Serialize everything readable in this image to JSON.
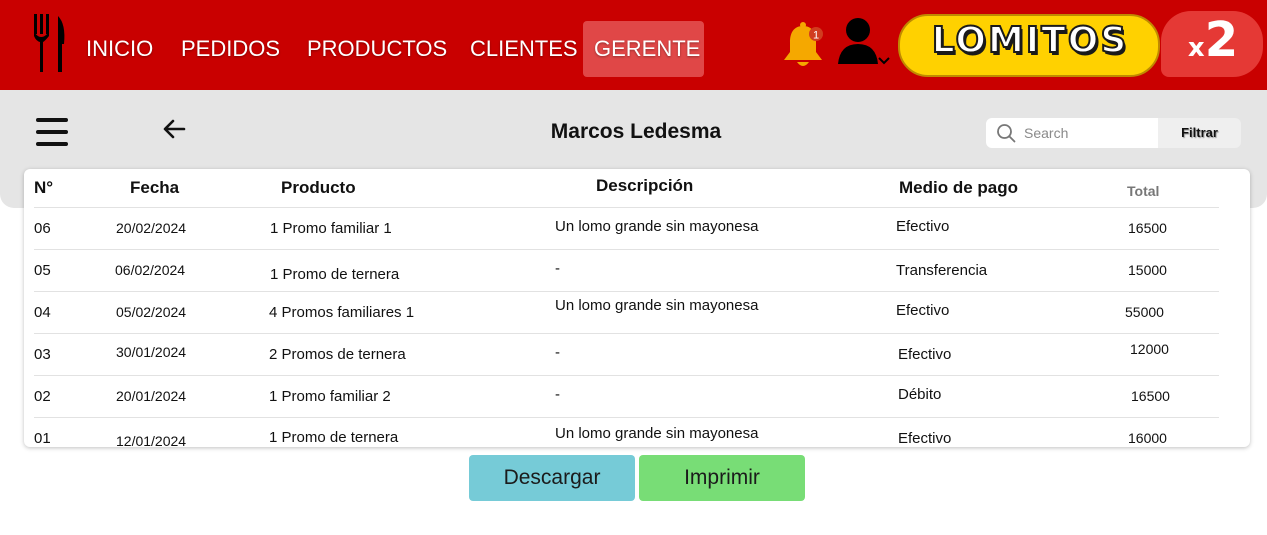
{
  "nav": {
    "items": [
      "INICIO",
      "PEDIDOS",
      "PRODUCTOS",
      "CLIENTES",
      "GERENTE"
    ],
    "active": "GERENTE",
    "notification_count": "1"
  },
  "brand": {
    "name": "LOMITOS",
    "multiplier_x": "x",
    "multiplier_n": "2"
  },
  "header": {
    "title": "Marcos Ledesma"
  },
  "search": {
    "placeholder": "Search",
    "filter_label": "Filtrar"
  },
  "table": {
    "columns": [
      "N°",
      "Fecha",
      "Producto",
      "Descripción",
      "Medio de pago",
      "Total"
    ],
    "rows": [
      [
        "06",
        "20/02/2024",
        "1 Promo familiar 1",
        "Un lomo grande sin mayonesa",
        "Efectivo",
        "16500"
      ],
      [
        "05",
        "06/02/2024",
        "1 Promo de ternera",
        "-",
        "Transferencia",
        "15000"
      ],
      [
        "04",
        "05/02/2024",
        "4 Promos familiares 1",
        "Un lomo grande sin mayonesa",
        "Efectivo",
        "55000"
      ],
      [
        "03",
        "30/01/2024",
        "2 Promos de ternera",
        "-",
        "Efectivo",
        "12000"
      ],
      [
        "02",
        "20/01/2024",
        "1 Promo familiar 2",
        "-",
        "Débito",
        "16500"
      ],
      [
        "01",
        "12/01/2024",
        "1 Promo de ternera",
        "Un lomo grande sin mayonesa",
        "Efectivo",
        "16000"
      ]
    ]
  },
  "actions": {
    "download_label": "Descargar",
    "print_label": "Imprimir"
  },
  "colors": {
    "topbar": "#c90000",
    "active_nav": "#e04747",
    "brand_yellow": "#ffd100",
    "brand_red": "#e53935",
    "download": "#76cbd7",
    "print": "#78dd76"
  },
  "icons": [
    "fork-knife-icon",
    "bell-icon",
    "user-icon",
    "chevron-down-icon",
    "hamburger-menu-icon",
    "back-arrow-icon",
    "search-icon"
  ]
}
